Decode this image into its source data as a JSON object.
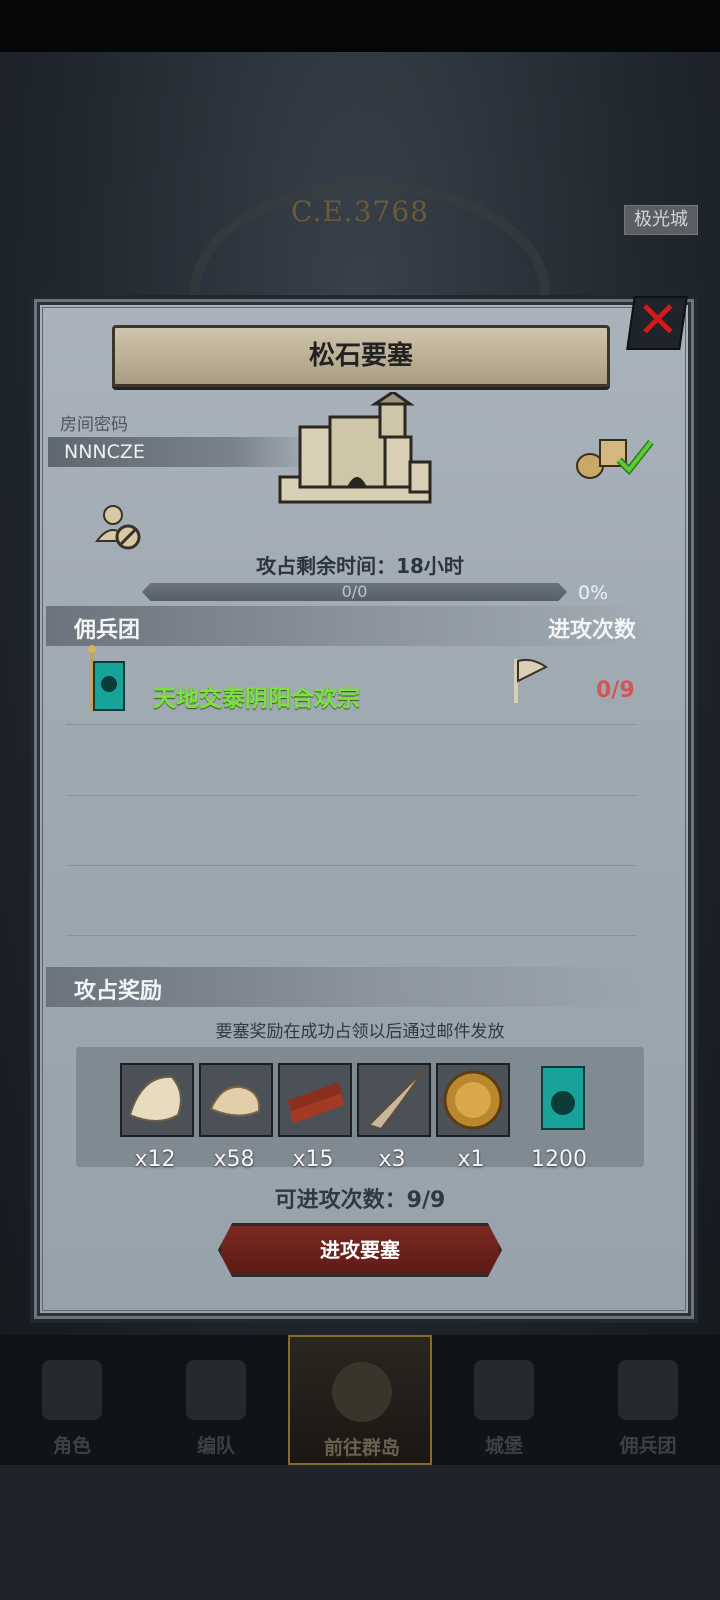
{
  "header": {
    "year": "C.E.3768",
    "city": "极光城"
  },
  "panel": {
    "title": "松石要塞",
    "room_label": "房间密码",
    "room_code": "NNNCZE",
    "time_remaining": "攻占剩余时间：18小时",
    "progress": {
      "text": "0/0",
      "percent_label": "0%",
      "fraction": 0
    },
    "mercenary_header": "佣兵团",
    "attack_count_header": "进攻次数",
    "guilds": [
      {
        "name": "天地交泰阴阳合欢宗",
        "attacks": "0/9"
      }
    ],
    "rewards_header": "攻占奖励",
    "reward_note": "要塞奖励在成功占领以后通过邮件发放",
    "rewards": [
      {
        "icon": "white-fur-icon",
        "qty": "x12"
      },
      {
        "icon": "hide-leather-icon",
        "qty": "x58"
      },
      {
        "icon": "wood-planks-icon",
        "qty": "x15"
      },
      {
        "icon": "horn-icon",
        "qty": "x3"
      },
      {
        "icon": "helmet-medal-icon",
        "qty": "x1"
      },
      {
        "icon": "guild-banner-icon",
        "qty": "1200"
      }
    ],
    "available_attacks": "可进攻次数：9/9",
    "attack_button": "进攻要塞",
    "colors": {
      "guild_name": "#7de23c",
      "attack_count": "#d15757",
      "close": "#d11b1b"
    }
  },
  "nav": {
    "items": [
      {
        "label": "角色",
        "icon": "knight-icon"
      },
      {
        "label": "编队",
        "icon": "helmet-icon"
      },
      {
        "label": "前往群岛",
        "icon": "compass-icon",
        "active": true
      },
      {
        "label": "城堡",
        "icon": "castle-icon"
      },
      {
        "label": "佣兵团",
        "icon": "ship-icon"
      }
    ]
  }
}
